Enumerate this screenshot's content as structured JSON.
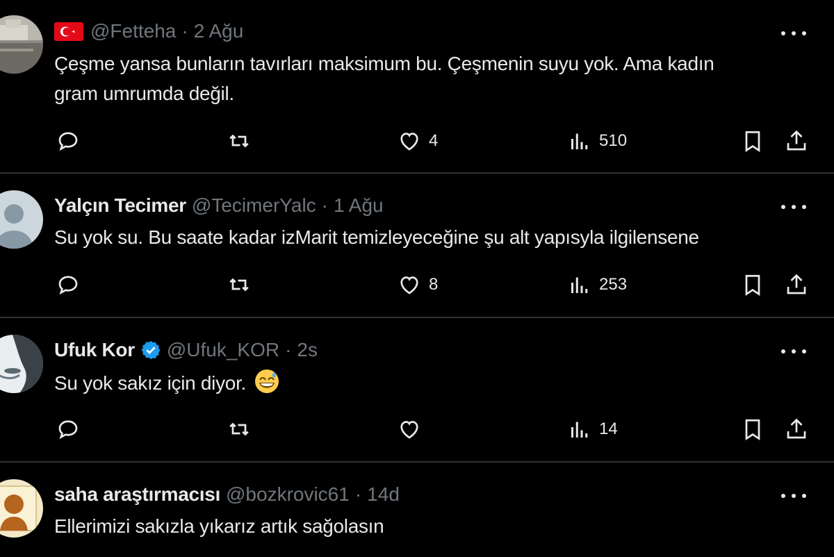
{
  "tweets": [
    {
      "name": "",
      "handle": "@Fetteha",
      "time": "2 Ağu",
      "text": "Çeşme yansa bunların tavırları maksimum bu. Çeşmenin suyu yok. Ama kadın gram umrumda değil.",
      "replies": "",
      "retweets": "",
      "likes": "4",
      "views": "510"
    },
    {
      "name": "Yalçın Tecimer",
      "handle": "@TecimerYalc",
      "time": "1 Ağu",
      "text": "Su yok su. Bu saate kadar izMarit temizleyeceğine şu alt yapısyla ilgilensene",
      "replies": "",
      "retweets": "",
      "likes": "8",
      "views": "253"
    },
    {
      "name": "Ufuk Kor",
      "handle": "@Ufuk_KOR",
      "time": "2s",
      "text": "Su yok sakız için diyor.",
      "replies": "",
      "retweets": "",
      "likes": "",
      "views": "14"
    },
    {
      "name": "saha araştırmacısı",
      "handle": "@bozkrovic61",
      "time": "14d",
      "text": "Ellerimizi sakızla yıkarız artık sağolasın"
    }
  ],
  "icons": {
    "reply": "reply-icon",
    "retweet": "retweet-icon",
    "like": "heart-icon",
    "views": "views-icon",
    "bookmark": "bookmark-icon",
    "share": "share-icon",
    "more": "more-icon",
    "verified": "verified-badge-icon",
    "flag": "turkey-flag-icon",
    "emoji": "grinning-sweat-emoji-icon"
  },
  "colors": {
    "background": "#000000",
    "text": "#e7e9ea",
    "secondary": "#71767b",
    "divider": "#2f3336",
    "verified": "#1d9bf0",
    "flag": "#e30a17"
  }
}
